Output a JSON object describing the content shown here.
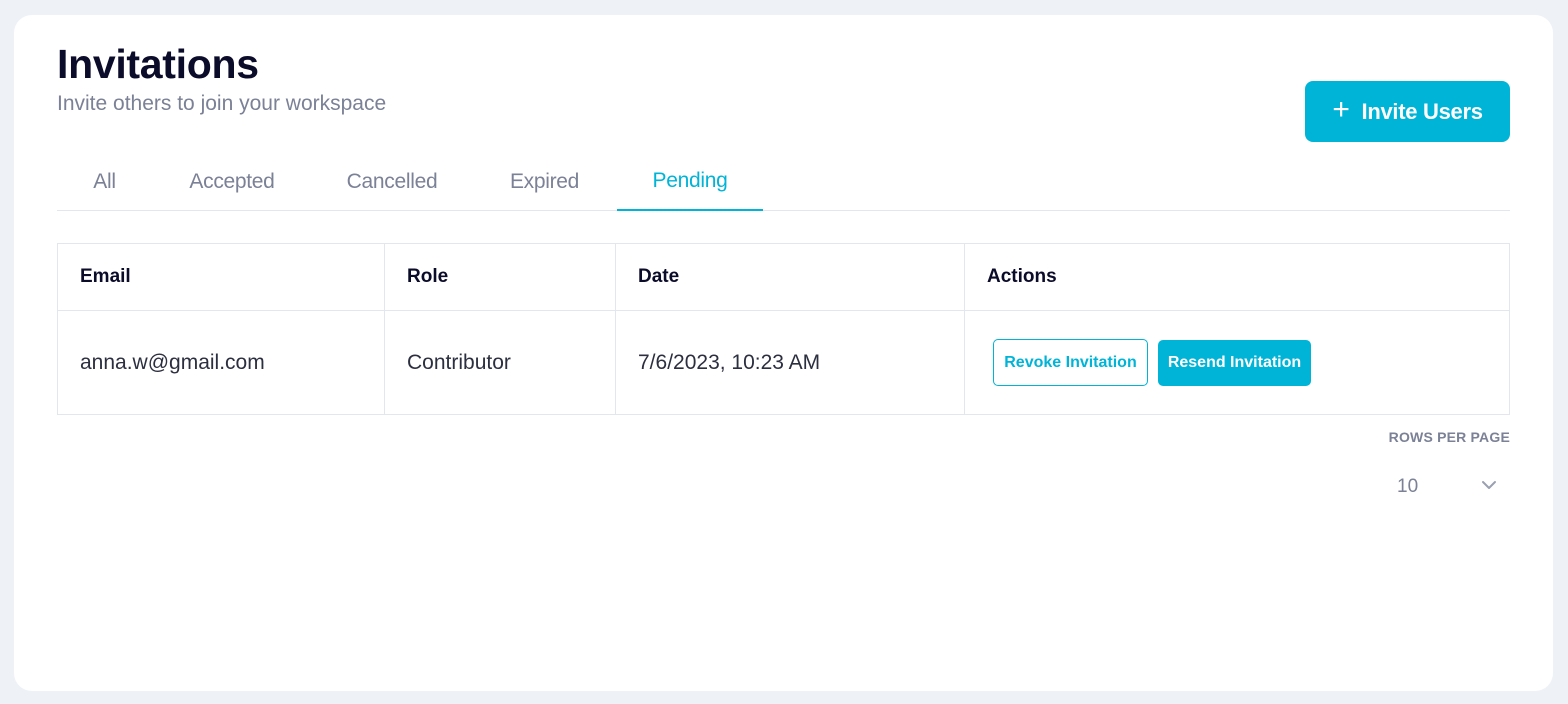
{
  "header": {
    "title": "Invitations",
    "subtitle": "Invite others to join your workspace",
    "invite_button_label": "Invite Users",
    "invite_button_icon": "plus-icon"
  },
  "tabs": [
    {
      "label": "All",
      "active": false
    },
    {
      "label": "Accepted",
      "active": false
    },
    {
      "label": "Cancelled",
      "active": false
    },
    {
      "label": "Expired",
      "active": false
    },
    {
      "label": "Pending",
      "active": true
    }
  ],
  "table": {
    "columns": [
      "Email",
      "Role",
      "Date",
      "Actions"
    ],
    "rows": [
      {
        "email": "anna.w@gmail.com",
        "role": "Contributor",
        "date": "7/6/2023, 10:23 AM",
        "revoke_label": "Revoke Invitation",
        "resend_label": "Resend Invitation"
      }
    ]
  },
  "pagination": {
    "rows_per_page_label": "ROWS PER PAGE",
    "rows_per_page_value": "10",
    "dropdown_icon": "chevron-down-icon"
  },
  "colors": {
    "accent": "#00b4d8",
    "title": "#0b0b2a",
    "muted": "#7b8196",
    "background": "#eef2f6",
    "border": "#e3e6ec"
  }
}
